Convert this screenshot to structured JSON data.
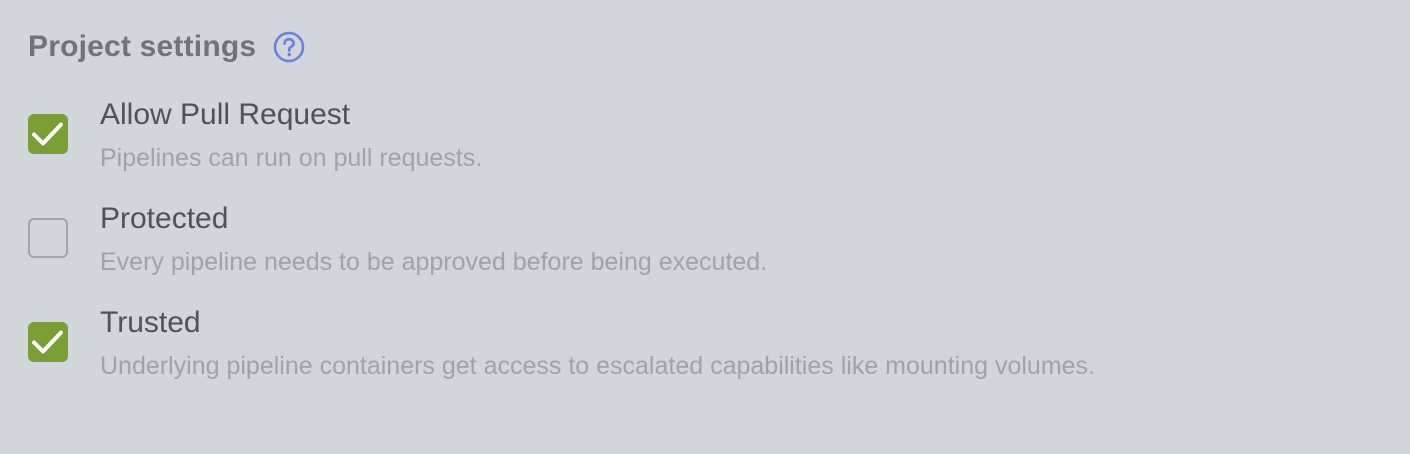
{
  "header": {
    "title": "Project settings",
    "help_icon": "question-circle-icon"
  },
  "colors": {
    "background": "#d2d5da",
    "checked": "#7a9e36",
    "help_accent": "#6a7fe0",
    "label": "#4d525c",
    "description": "#9ea2ab"
  },
  "options": [
    {
      "label": "Allow Pull Request",
      "description": "Pipelines can run on pull requests.",
      "checked": true
    },
    {
      "label": "Protected",
      "description": "Every pipeline needs to be approved before being executed.",
      "checked": false
    },
    {
      "label": "Trusted",
      "description": "Underlying pipeline containers get access to escalated capabilities like mounting volumes.",
      "checked": true
    }
  ]
}
